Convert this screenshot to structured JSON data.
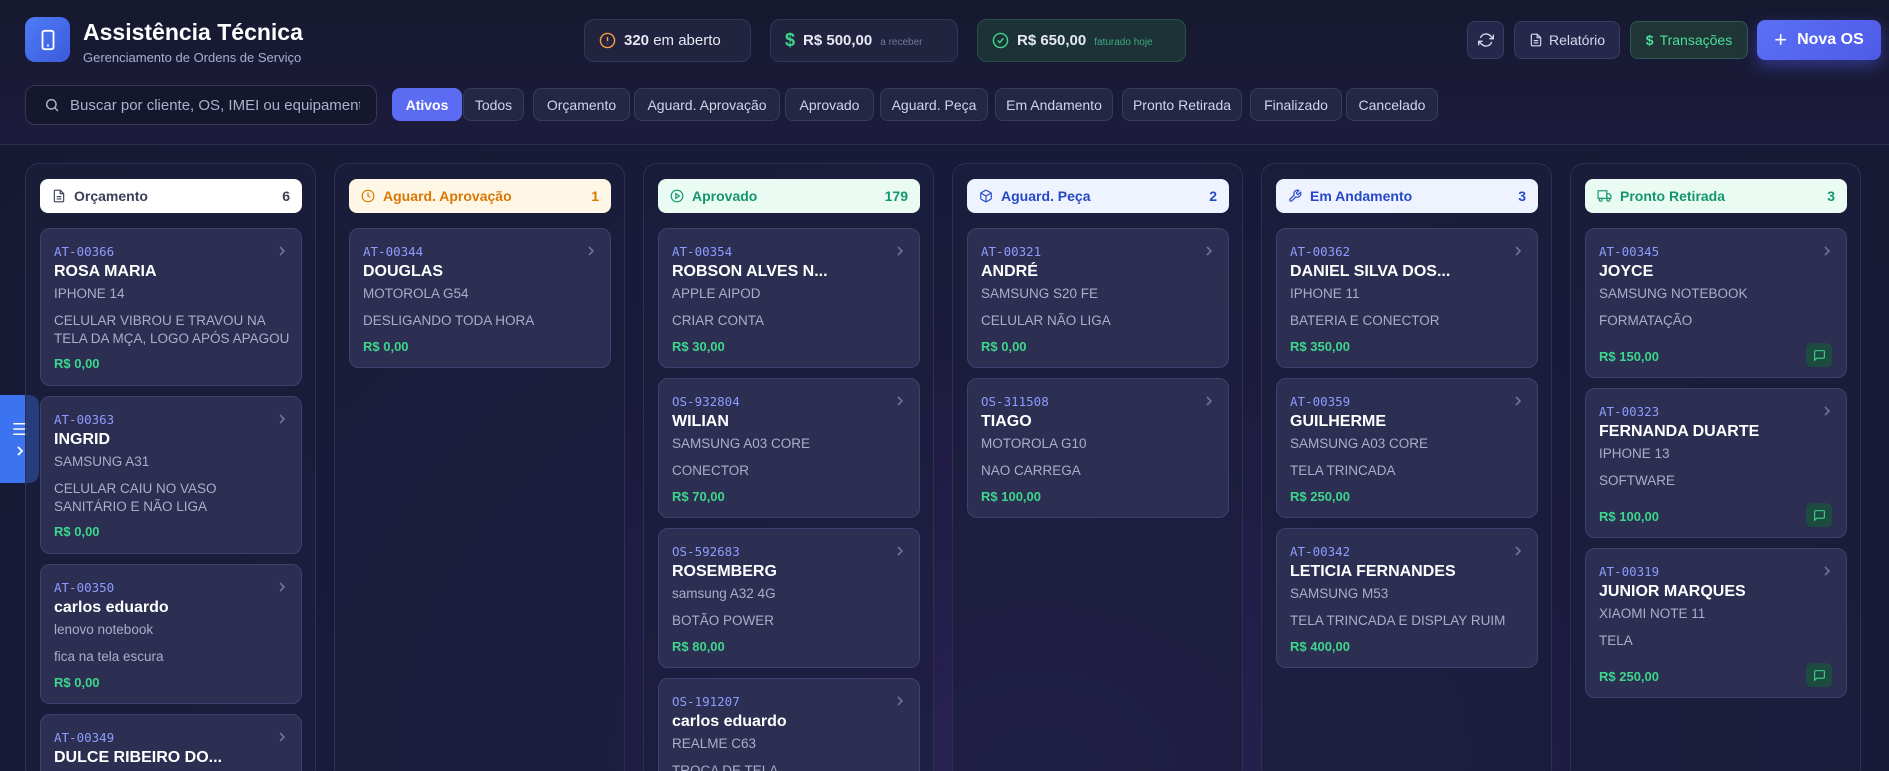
{
  "app": {
    "title": "Assistência Técnica",
    "subtitle": "Gerenciamento de Ordens de Serviço"
  },
  "stats": [
    {
      "icon": "alert-circle-icon",
      "value": "320",
      "label": "em aberto",
      "color": "#f59e42"
    },
    {
      "icon": "dollar-icon",
      "value": "R$ 500,00",
      "label": "a receber",
      "color": "#3dd68c"
    },
    {
      "icon": "check-circle-icon",
      "value": "R$ 650,00",
      "label": "faturado hoje",
      "color": "#3dd68c"
    }
  ],
  "actions": {
    "refresh": "refresh-icon",
    "report": "Relatório",
    "transactions": "Transações",
    "new_os": "Nova OS"
  },
  "search": {
    "placeholder": "Buscar por cliente, OS, IMEI ou equipamento"
  },
  "filters": [
    "Ativos",
    "Todos",
    "Orçamento",
    "Aguard. Aprovação",
    "Aprovado",
    "Aguard. Peça",
    "Em Andamento",
    "Pronto Retirada",
    "Finalizado",
    "Cancelado"
  ],
  "active_filter": "Ativos",
  "columns": [
    {
      "title": "Orçamento",
      "count": "6",
      "icon": "document-icon",
      "color": "#3b3f55",
      "bg": "#ffffff",
      "cards": [
        {
          "code": "AT-00366",
          "name": "ROSA MARIA",
          "device": "IPHONE 14",
          "issue": "CELULAR VIBROU E TRAVOU NA TELA DA MÇA, LOGO APÓS APAGOU",
          "price": "R$ 0,00"
        },
        {
          "code": "AT-00363",
          "name": "INGRID",
          "device": "SAMSUNG A31",
          "issue": "CELULAR CAIU NO VASO SANITÁRIO E NÃO LIGA",
          "price": "R$ 0,00"
        },
        {
          "code": "AT-00350",
          "name": "carlos eduardo",
          "device": "lenovo notebook",
          "issue": "fica na tela escura",
          "price": "R$ 0,00"
        },
        {
          "code": "AT-00349",
          "name": "DULCE RIBEIRO DO...",
          "device": "",
          "issue": "",
          "price": ""
        }
      ]
    },
    {
      "title": "Aguard. Aprovação",
      "count": "1",
      "icon": "clock-icon",
      "color": "#d97706",
      "bg": "#fff7e6",
      "cards": [
        {
          "code": "AT-00344",
          "name": "DOUGLAS",
          "device": "MOTOROLA G54",
          "issue": "DESLIGANDO TODA HORA",
          "price": "R$ 0,00"
        }
      ]
    },
    {
      "title": "Aprovado",
      "count": "179",
      "icon": "play-circle-icon",
      "color": "#15966a",
      "bg": "#eafbf3",
      "cards": [
        {
          "code": "AT-00354",
          "name": "ROBSON ALVES N...",
          "device": "APPLE AIPOD",
          "issue": "CRIAR CONTA",
          "price": "R$ 30,00"
        },
        {
          "code": "OS-932804",
          "name": "WILIAN",
          "device": "SAMSUNG A03 CORE",
          "issue": "CONECTOR",
          "price": "R$ 70,00"
        },
        {
          "code": "OS-592683",
          "name": "ROSEMBERG",
          "device": "samsung A32 4G",
          "issue": "BOTÃO POWER",
          "price": "R$ 80,00"
        },
        {
          "code": "OS-191207",
          "name": "carlos eduardo",
          "device": "REALME C63",
          "issue": "TROCA DE TELA",
          "price": ""
        }
      ]
    },
    {
      "title": "Aguard. Peça",
      "count": "2",
      "icon": "package-icon",
      "color": "#2548c7",
      "bg": "#eef3ff",
      "cards": [
        {
          "code": "AT-00321",
          "name": "ANDRÉ",
          "device": "SAMSUNG S20 FE",
          "issue": "CELULAR NÃO LIGA",
          "price": "R$ 0,00"
        },
        {
          "code": "OS-311508",
          "name": "TIAGO",
          "device": "MOTOROLA G10",
          "issue": "NAO CARREGA",
          "price": "R$ 100,00"
        }
      ]
    },
    {
      "title": "Em Andamento",
      "count": "3",
      "icon": "wrench-icon",
      "color": "#2548c7",
      "bg": "#eef3ff",
      "cards": [
        {
          "code": "AT-00362",
          "name": "DANIEL SILVA DOS...",
          "device": "IPHONE 11",
          "issue": "BATERIA E CONECTOR",
          "price": "R$ 350,00"
        },
        {
          "code": "AT-00359",
          "name": "GUILHERME",
          "device": "SAMSUNG A03 CORE",
          "issue": "TELA TRINCADA",
          "price": "R$ 250,00"
        },
        {
          "code": "AT-00342",
          "name": "LETICIA FERNANDES",
          "device": "SAMSUNG M53",
          "issue": "TELA TRINCADA E DISPLAY RUIM",
          "price": "R$ 400,00"
        }
      ]
    },
    {
      "title": "Pronto Retirada",
      "count": "3",
      "icon": "truck-icon",
      "color": "#15966a",
      "bg": "#eafbf3",
      "cards": [
        {
          "code": "AT-00345",
          "name": "JOYCE",
          "device": "SAMSUNG NOTEBOOK",
          "issue": "FORMATAÇÃO",
          "price": "R$ 150,00"
        },
        {
          "code": "AT-00323",
          "name": "FERNANDA DUARTE",
          "device": "IPHONE 13",
          "issue": "SOFTWARE",
          "price": "R$ 100,00"
        },
        {
          "code": "AT-00319",
          "name": "JUNIOR MARQUES",
          "device": "XIAOMI NOTE 11",
          "issue": "TELA",
          "price": "R$ 250,00"
        }
      ]
    }
  ]
}
